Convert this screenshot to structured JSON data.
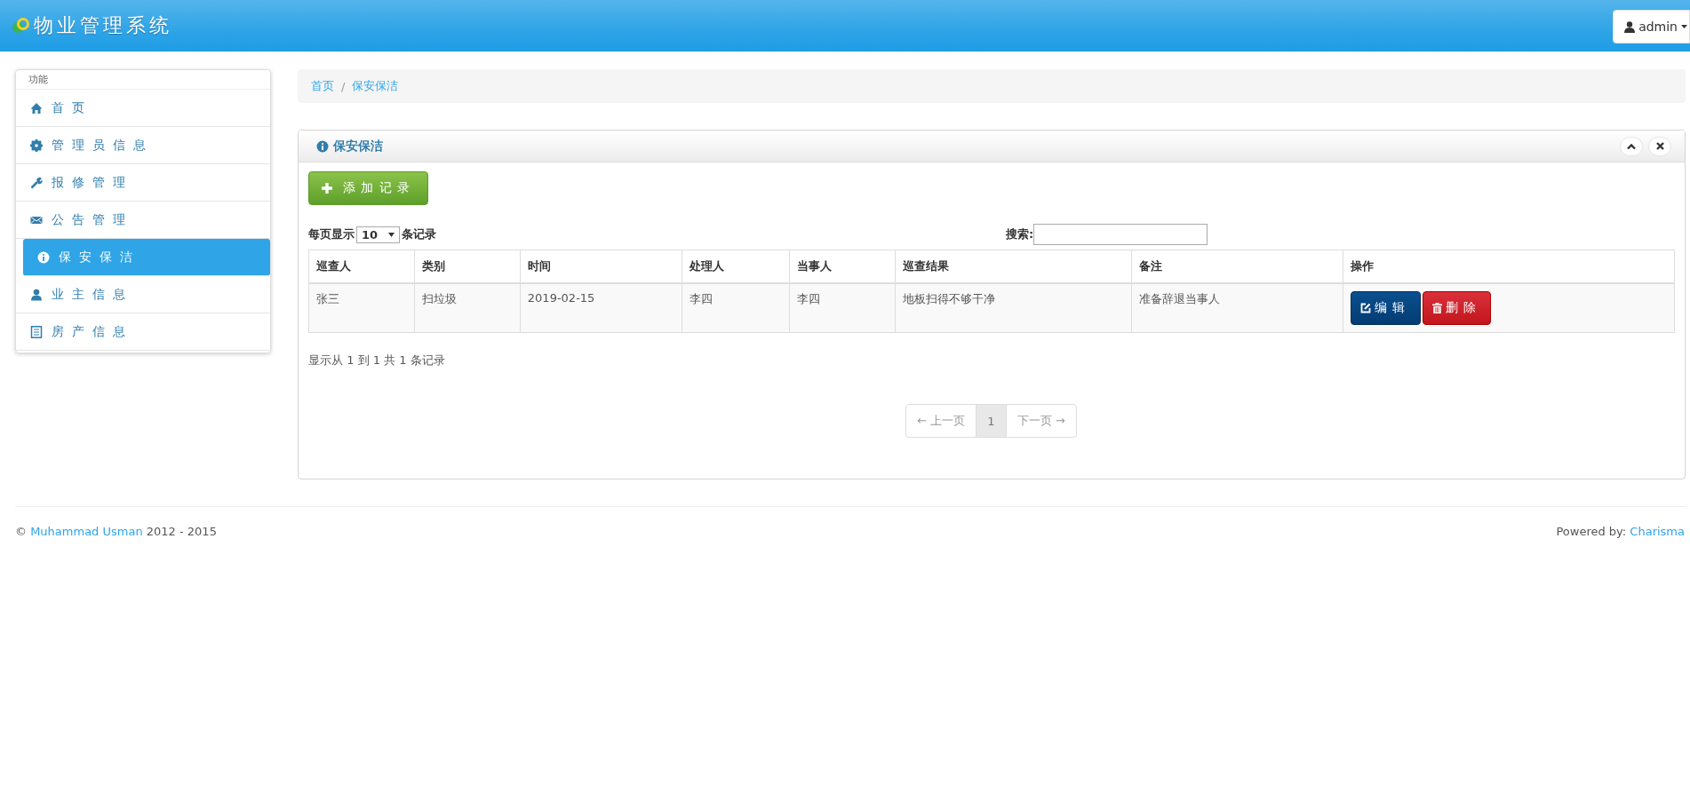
{
  "header": {
    "title": "物业管理系统",
    "user_menu": "admin"
  },
  "sidebar": {
    "heading": "功能",
    "items": [
      {
        "label": "首页",
        "selected": false
      },
      {
        "label": "管理员信息",
        "selected": false
      },
      {
        "label": "报修管理",
        "selected": false
      },
      {
        "label": "公告管理",
        "selected": false
      },
      {
        "label": "保安保洁",
        "selected": true
      },
      {
        "label": "业主信息",
        "selected": false
      },
      {
        "label": "房产信息",
        "selected": false
      }
    ]
  },
  "breadcrumb": {
    "separator": "/",
    "items": [
      "首页",
      "保安保洁"
    ]
  },
  "panel": {
    "title": "保安保洁",
    "add_button": "添加记录",
    "page_size": {
      "label_before": "每页显示",
      "value": "10",
      "label_after": "条记录"
    },
    "search": {
      "label": "搜索:"
    },
    "table": {
      "columns": [
        "巡查人",
        "类别",
        "时间",
        "处理人",
        "当事人",
        "巡查结果",
        "备注",
        "操作"
      ],
      "rows": [
        {
          "cells": [
            "张三",
            "扫垃圾",
            "2019-02-15",
            "李四",
            "李四",
            "地板扫得不够干净",
            "准备辞退当事人"
          ],
          "actions": [
            "编辑",
            "删除"
          ]
        }
      ]
    },
    "info": "显示从 1 到 1 共 1 条记录",
    "pagination": [
      {
        "label": "← 上一页",
        "selected": false
      },
      {
        "label": "1",
        "selected": true
      },
      {
        "label": "下一页 →",
        "selected": false
      }
    ]
  },
  "footer": {
    "copyright_prefix": "©",
    "author": "Muhammad Usman",
    "years": "2012 - 2015",
    "powered_label": "Powered by:",
    "powered_link": "Charisma"
  }
}
